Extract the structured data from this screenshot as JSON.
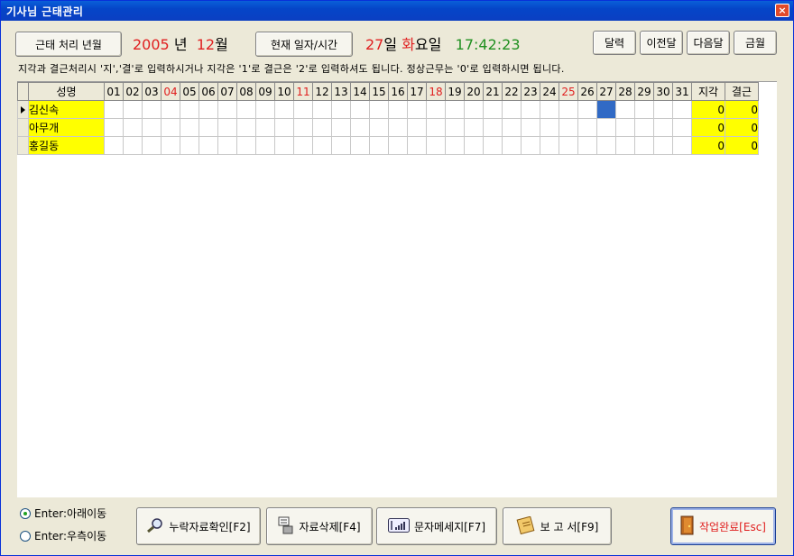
{
  "window": {
    "title": "기사님 근태관리",
    "close": "×"
  },
  "header": {
    "period_btn": "근태 처리 년월",
    "year": "2005",
    "year_unit": "년",
    "month": "12",
    "month_unit": "월",
    "now_btn": "현재 일자/시간",
    "day": "27",
    "day_unit": "일",
    "weekday": "화",
    "weekday_unit": "요일",
    "time": "17:42:23",
    "calendar_btn": "달력",
    "prev_btn": "이전달",
    "next_btn": "다음달",
    "this_btn": "금월"
  },
  "note": "지각과 결근처리시 '지','결'로 입력하시거나 지각은 '1'로 결근은 '2'로 입력하셔도 됩니다.  정상근무는 '0'로 입력하시면 됩니다.",
  "grid": {
    "name_header": "성명",
    "days": [
      "01",
      "02",
      "03",
      "04",
      "05",
      "06",
      "07",
      "08",
      "09",
      "10",
      "11",
      "12",
      "13",
      "14",
      "15",
      "16",
      "17",
      "18",
      "19",
      "20",
      "21",
      "22",
      "23",
      "24",
      "25",
      "26",
      "27",
      "28",
      "29",
      "30",
      "31"
    ],
    "red_days": [
      "04",
      "11",
      "18",
      "25"
    ],
    "late_header": "지각",
    "absent_header": "결근",
    "rows": [
      {
        "name": "김신속",
        "late": "0",
        "absent": "0"
      },
      {
        "name": "아무개",
        "late": "0",
        "absent": "0"
      },
      {
        "name": "홍길동",
        "late": "0",
        "absent": "0"
      }
    ],
    "selected_row": 0,
    "selected_day": "27"
  },
  "footer": {
    "radio_down": "Enter:아래이동",
    "radio_right": "Enter:우측이동",
    "missing_btn": "누락자료확인[F2]",
    "delete_btn": "자료삭제[F4]",
    "sms_btn": "문자메세지[F7]",
    "report_btn": "보 고 서[F9]",
    "done_btn": "작업완료[Esc]"
  },
  "colors": {
    "title_bar": "#0545c8",
    "highlight": "#ffff00",
    "selected": "#316ac5",
    "red": "#e02020",
    "green": "#209020"
  }
}
